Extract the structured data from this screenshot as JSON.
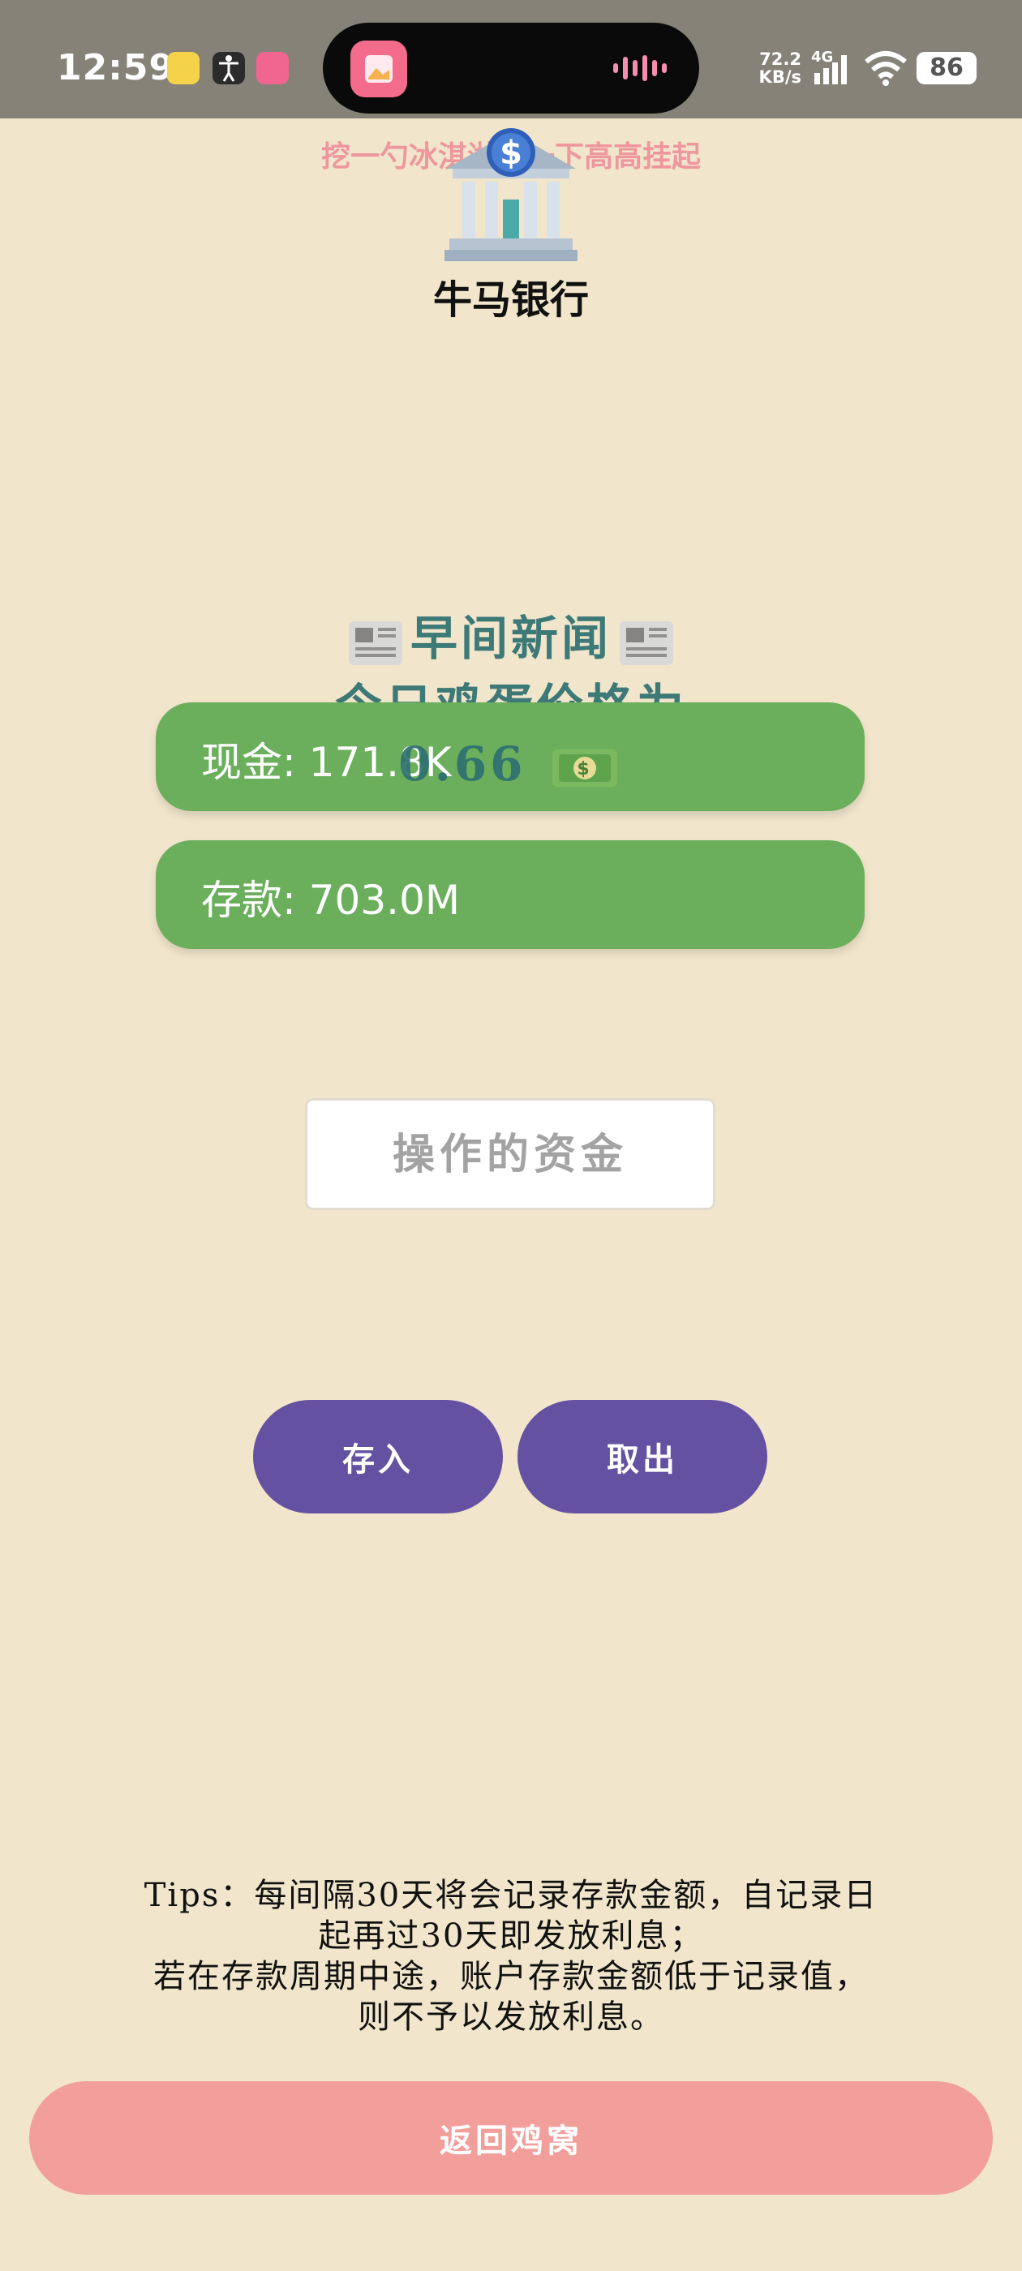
{
  "status_bar": {
    "time": "12:59",
    "network_speed": "72.2",
    "network_unit": "KB/s",
    "network_type": "4G",
    "battery": "86",
    "icons": [
      "music-app-icon",
      "accessibility-icon",
      "bilibili-icon",
      "wifi-icon",
      "signal-icon"
    ]
  },
  "header": {
    "banner_text": "挖一勺冰淇淋，一下高高挂起",
    "title": "牛马银行",
    "icon": "bank-icon"
  },
  "news": {
    "heading": "早间新闻",
    "line1": "今日鸡蛋价格为",
    "price": "0.66",
    "icons": [
      "newspaper-icon",
      "money-icon"
    ]
  },
  "balances": {
    "cash": "现金: 171.8K",
    "deposit": "存款: 703.0M"
  },
  "input": {
    "placeholder": "操作的资金",
    "value": ""
  },
  "actions": {
    "deposit_label": "存入",
    "withdraw_label": "取出"
  },
  "tips": {
    "line1": "Tips：每间隔30天将会记录存款金额，自记录日",
    "line2": "起再过30天即发放利息；",
    "line3": "若在存款周期中途，账户存款金额低于记录值，",
    "line4": "则不予以发放利息。"
  },
  "footer": {
    "back_label": "返回鸡窝"
  },
  "colors": {
    "background": "#F1E6CC",
    "card_green": "#6BAF5C",
    "button_purple": "#6551A1",
    "back_button_pink": "#F29F9C",
    "news_teal": "#2E7070"
  }
}
